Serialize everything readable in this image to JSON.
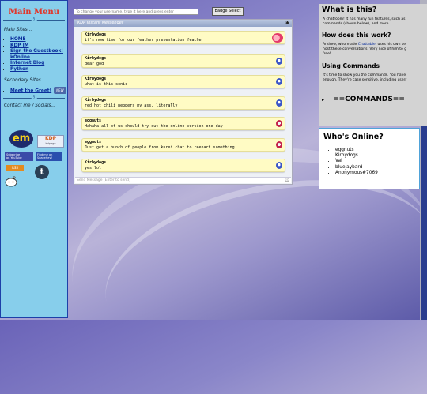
{
  "sidebar": {
    "title": "Main Menu",
    "sep_mark": "§",
    "main_sites_label": "Main Sites...",
    "main_links": [
      "HOME",
      "KDP IM",
      "Sign the Guestbook!",
      "kOnline",
      "Internet Blog",
      "Python"
    ],
    "secondary_label": "Secondary Sites...",
    "secondary_link": "Meet the Greet!",
    "new_badge": "NEW",
    "contact_label": "Contact me / Socials...",
    "social_badges": {
      "em": "em",
      "kdp": "KDP",
      "kdp_sub": "kdpage",
      "subscribe": "Subscribe\non YouTube",
      "spacehey": "Find me on\nSpaceHey!",
      "rss": "RSS"
    }
  },
  "chat": {
    "username_placeholder": "To change your username, type it here and press enter",
    "badge_button": "Badge Select",
    "title": "KDP Instant Messenger",
    "send_placeholder": "Send Message [Enter to send]",
    "messages": [
      {
        "name": "Kirbydogs",
        "text": "it's now time for our feather presentation feather",
        "avatar": "big"
      },
      {
        "name": "Kirbydogs",
        "text": "dear god",
        "avatar": "kirby"
      },
      {
        "name": "Kirbydogs",
        "text": "what is this sonic",
        "avatar": "kirby"
      },
      {
        "name": "Kirbydogs",
        "text": "red hot chili peppers my ass. literally",
        "avatar": "kirby"
      },
      {
        "name": "eggnuts",
        "text": "Hahaha all of us should try out the online version one day",
        "avatar": "egg"
      },
      {
        "name": "eggnuts",
        "text": "Just get a bunch of people from kurei chat to reenact something",
        "avatar": "egg"
      },
      {
        "name": "Kirbydogs",
        "text": "yes lol",
        "avatar": "kirby"
      }
    ]
  },
  "info": {
    "title": "What is this?",
    "intro": "A chatroom! It has many fun features, such as",
    "intro2": "commands (shown below), and more.",
    "how_title": "How does this work?",
    "how_text_pre": "Andrew, who made ",
    "how_link": "Chattable",
    "how_text_post": ", uses his own se",
    "how_text2": "host these conversations. Very nice of him to g",
    "how_text3": "free!",
    "using_title": "Using Commands",
    "using_text1": "It's time to show you the commands. You have",
    "using_text2": "enough. They're case sensitive, including userr",
    "commands_header": "==COMMANDS==",
    "commands_arrow": "▸"
  },
  "online": {
    "title": "Who's Online?",
    "users": [
      "eggnuts",
      "Kirbydogs",
      "Val",
      "bluejaybard",
      "Anonymous#7069"
    ]
  }
}
